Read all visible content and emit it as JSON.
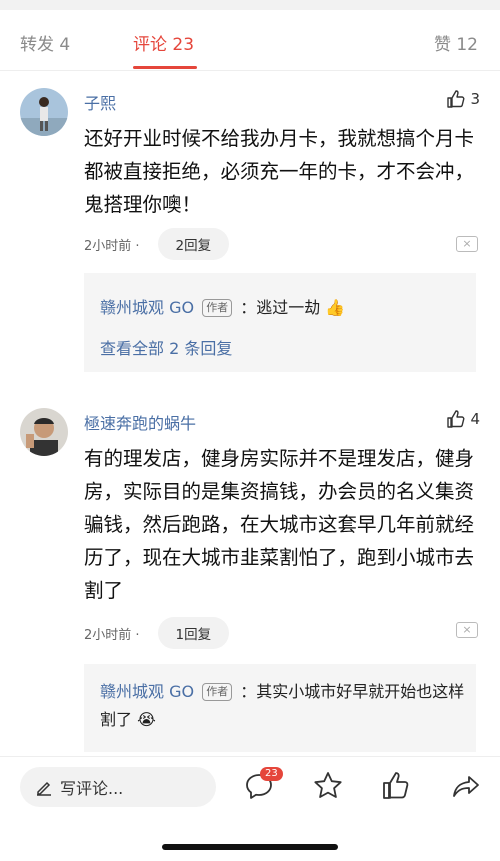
{
  "tabs": {
    "repost": "转发 4",
    "comments": "评论 23",
    "likes": "赞 12"
  },
  "comments": [
    {
      "user": "子熙",
      "likes": "3",
      "text": "还好开业时候不给我办月卡，我就想搞个月卡都被直接拒绝，必须充一年的卡，才不会冲，鬼搭理你噢！",
      "time": "2小时前 ·",
      "reply_count": "2回复",
      "reply_author": "赣州城观 GO",
      "author_tag": "作者",
      "reply_text": "：逃过一劫 👍",
      "view_all": "查看全部 2 条回复"
    },
    {
      "user": "極速奔跑的蜗牛",
      "likes": "4",
      "text": "有的理发店，健身房实际并不是理发店，健身房，实际目的是集资搞钱，办会员的名义集资骗钱，然后跑路，在大城市这套早几年前就经历了，现在大城市韭菜割怕了，跑到小城市去割了",
      "time": "2小时前 ·",
      "reply_count": "1回复",
      "reply_author": "赣州城观 GO",
      "author_tag": "作者",
      "reply_text": "：其实小城市好早就开始也这样割了 😭"
    }
  ],
  "close_label": "×",
  "bottom": {
    "write_placeholder": "写评论...",
    "comment_badge": "23"
  },
  "colors": {
    "accent": "#e5463b",
    "link": "#4a6fa5"
  }
}
